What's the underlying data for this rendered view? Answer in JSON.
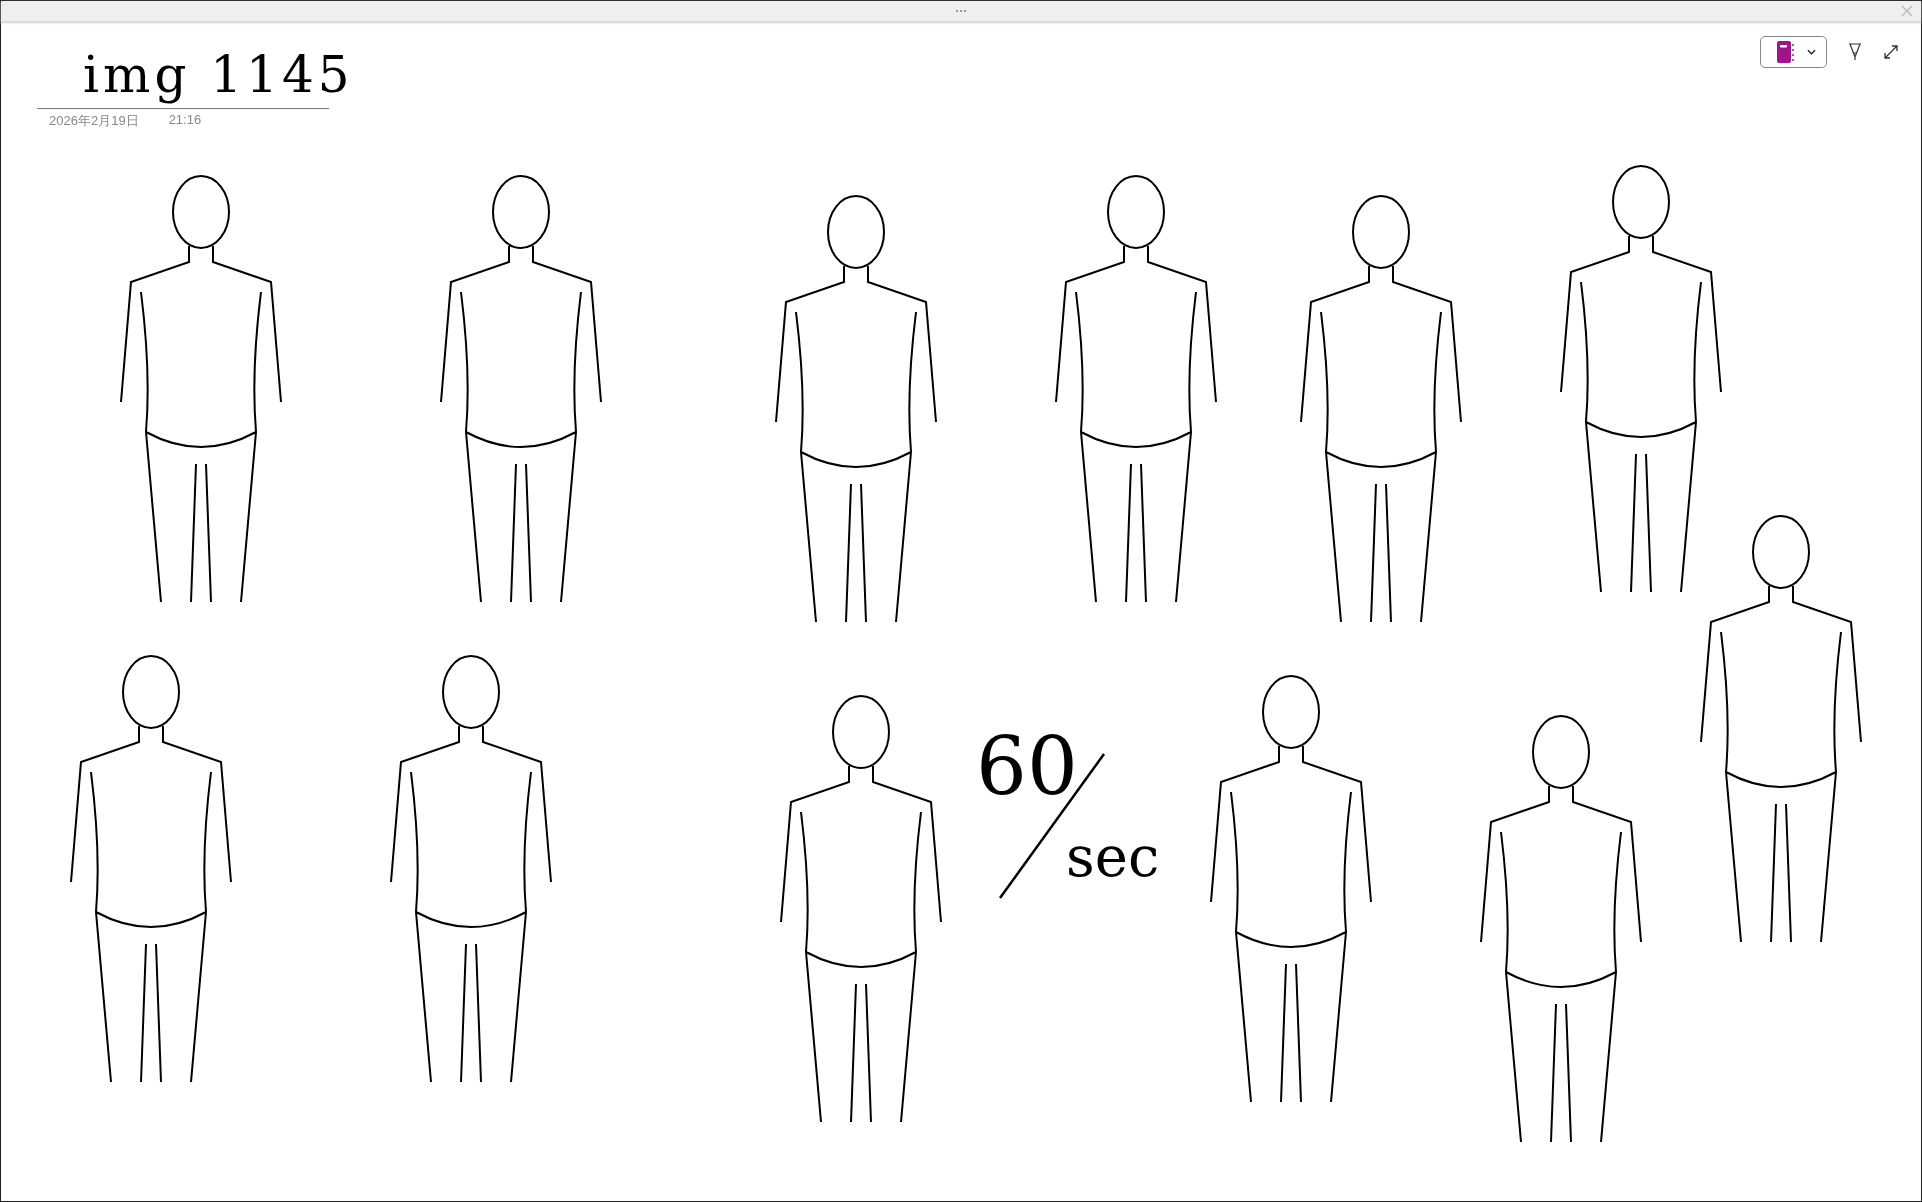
{
  "page": {
    "title": "img 1145",
    "date": "2026年2月19日",
    "time": "21:16"
  },
  "ink_notes": [
    "60",
    "sec"
  ]
}
